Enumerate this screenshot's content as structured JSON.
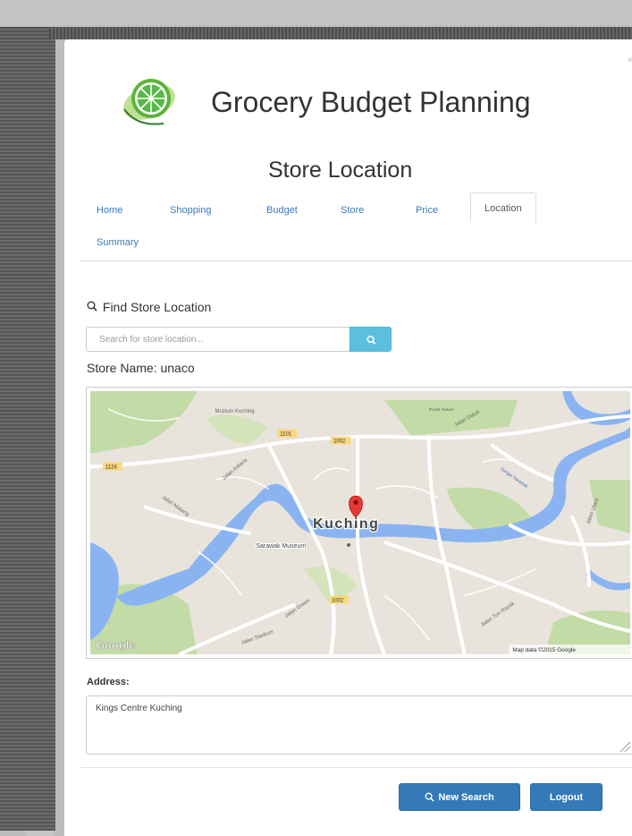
{
  "header": {
    "app_title": "Grocery Budget Planning",
    "page_title": "Store Location"
  },
  "tabs": [
    {
      "label": "Home"
    },
    {
      "label": "Shopping"
    },
    {
      "label": "Budget"
    },
    {
      "label": "Store"
    },
    {
      "label": "Price"
    },
    {
      "label": "Location",
      "active": true
    },
    {
      "label": "Summary"
    }
  ],
  "find": {
    "label": "Find Store Location",
    "search_placeholder": "Search for store location...",
    "search_icon": "search-icon"
  },
  "store": {
    "name_text": "Store Name: unaco"
  },
  "map": {
    "city_label": "Kuching",
    "poi_museum": "Sarawak Museum",
    "poi_muzium": "Muzium Kuching",
    "poi_topright": "Pusat Sukan",
    "roads": {
      "r1101": "1101",
      "r1002": "1002",
      "r1124": "1124",
      "r1002b": "1002",
      "jalan_astana": "Jalan Astana",
      "jalan_matang": "Jalan Matang",
      "jalan_datuk": "Jalan Datuk",
      "jalan_green": "Jalan Green",
      "jalan_stadium": "Jalan Stadium",
      "jalan_tun_razak": "Jalan Tun Razak",
      "jalan_utara": "Jalan Utara",
      "sungai": "Sungai Sarawak"
    },
    "google": "Google",
    "attribution": "Map data ©2015 Google",
    "colors": {
      "water": "#8ab4f1",
      "land": "#e8e4dc",
      "park": "#c3dba6",
      "road": "#ffffff",
      "highway": "#f8d878",
      "pin": "#e53935"
    }
  },
  "address": {
    "label": "Address:",
    "value": "Kings Centre Kuching"
  },
  "actions": {
    "new_search": "New Search",
    "logout": "Logout"
  },
  "colors": {
    "primary": "#337ab7",
    "info": "#5bc0de",
    "logo_green": "#4caf50",
    "link": "#3a7ab8"
  }
}
